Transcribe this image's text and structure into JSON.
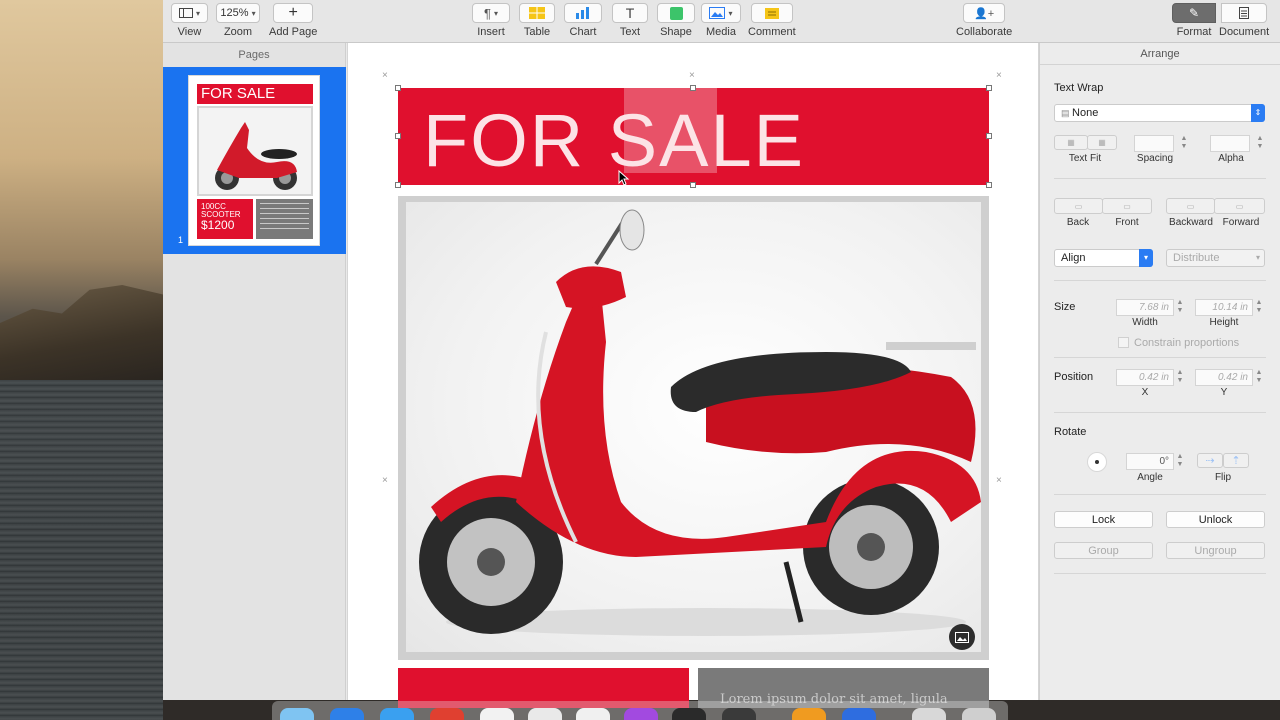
{
  "toolbar": {
    "view": {
      "label": "View"
    },
    "zoom": {
      "value": "125%",
      "label": "Zoom"
    },
    "add_page": {
      "label": "Add Page"
    },
    "insert": {
      "label": "Insert"
    },
    "table": {
      "label": "Table"
    },
    "chart": {
      "label": "Chart"
    },
    "text": {
      "label": "Text"
    },
    "shape": {
      "label": "Shape"
    },
    "media": {
      "label": "Media"
    },
    "comment": {
      "label": "Comment"
    },
    "collaborate": {
      "label": "Collaborate"
    },
    "format": {
      "label": "Format"
    },
    "document": {
      "label": "Document"
    }
  },
  "pages_panel": {
    "header": "Pages",
    "thumbnail": {
      "number": "1",
      "title": "FOR SALE",
      "line1": "100CC",
      "line2": "SCOOTER",
      "price": "$1200"
    }
  },
  "canvas": {
    "banner_text": "FOR SALE",
    "bottom_text": "Lorem ipsum dolor sit amet, ligula"
  },
  "inspector": {
    "tab": "Arrange",
    "text_wrap": {
      "label": "Text Wrap",
      "value": "None"
    },
    "text_fit": "Text Fit",
    "spacing": "Spacing",
    "alpha": "Alpha",
    "order": {
      "back": "Back",
      "front": "Front",
      "backward": "Backward",
      "forward": "Forward"
    },
    "align": {
      "value": "Align",
      "distribute": "Distribute"
    },
    "size": {
      "label": "Size",
      "width": "7.68 in",
      "width_label": "Width",
      "height": "10.14 in",
      "height_label": "Height",
      "constrain": "Constrain proportions"
    },
    "position": {
      "label": "Position",
      "x": "0.42 in",
      "x_label": "X",
      "y": "0.42 in",
      "y_label": "Y"
    },
    "rotate": {
      "label": "Rotate",
      "angle": "0°",
      "angle_label": "Angle",
      "flip_label": "Flip"
    },
    "lock": "Lock",
    "unlock": "Unlock",
    "group": "Group",
    "ungroup": "Ungroup"
  },
  "colors": {
    "accent": "#1a73f0",
    "brand_red": "#e0102e"
  }
}
